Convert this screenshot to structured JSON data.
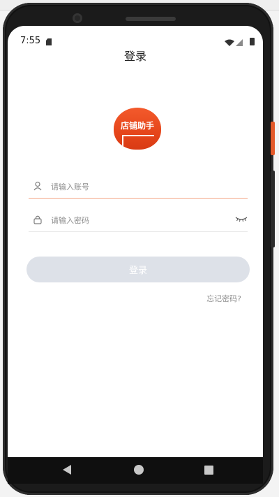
{
  "status": {
    "time": "7:55"
  },
  "header": {
    "title": "登录"
  },
  "logo": {
    "text": "店铺助手"
  },
  "form": {
    "account_placeholder": "请输入账号",
    "password_placeholder": "请输入密码",
    "login_label": "登录",
    "forgot_label": "忘记密码?"
  },
  "colors": {
    "accent": "#e44419",
    "button_disabled": "#dde1e8",
    "active_underline": "#f3a585"
  },
  "icons": {
    "account": "user-icon",
    "password": "lock-icon",
    "visibility": "eye-closed-icon"
  }
}
